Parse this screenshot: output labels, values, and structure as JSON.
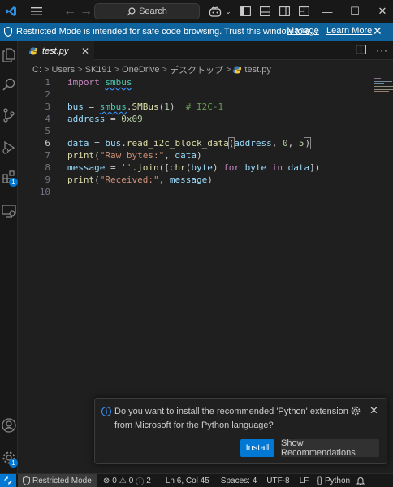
{
  "titlebar": {
    "search_label": "Search",
    "minimize": "—",
    "maximize": "☐",
    "close": "✕"
  },
  "banner": {
    "message": "Restricted Mode is intended for safe code browsing. Trust this window to e...",
    "manage": "Manage",
    "learn_more": "Learn More",
    "close": "✕"
  },
  "activitybar": {
    "extensions_badge": "1",
    "remote_badge": "1"
  },
  "tab": {
    "label": "test.py",
    "close": "✕"
  },
  "breadcrumb": {
    "parts": [
      "C:",
      "Users",
      "SK191",
      "OneDrive",
      "デスクトップ",
      "test.py"
    ],
    "separator": ">"
  },
  "editor": {
    "line_numbers": [
      "1",
      "2",
      "3",
      "4",
      "5",
      "6",
      "7",
      "8",
      "9",
      "10"
    ],
    "active_line": 6
  },
  "notification": {
    "message": "Do you want to install the recommended 'Python' extension from Microsoft for the Python language?",
    "install": "Install",
    "show_recommendations": "Show Recommendations",
    "close": "✕"
  },
  "statusbar": {
    "restricted": "Restricted Mode",
    "errors": "0",
    "warnings": "0",
    "info": "2",
    "position": "Ln 6, Col 45",
    "spaces": "Spaces: 4",
    "encoding": "UTF-8",
    "eol": "LF",
    "language": "Python"
  },
  "colors": {
    "accent": "#0078d4",
    "banner": "#0e639c",
    "background": "#1f1f1f"
  }
}
